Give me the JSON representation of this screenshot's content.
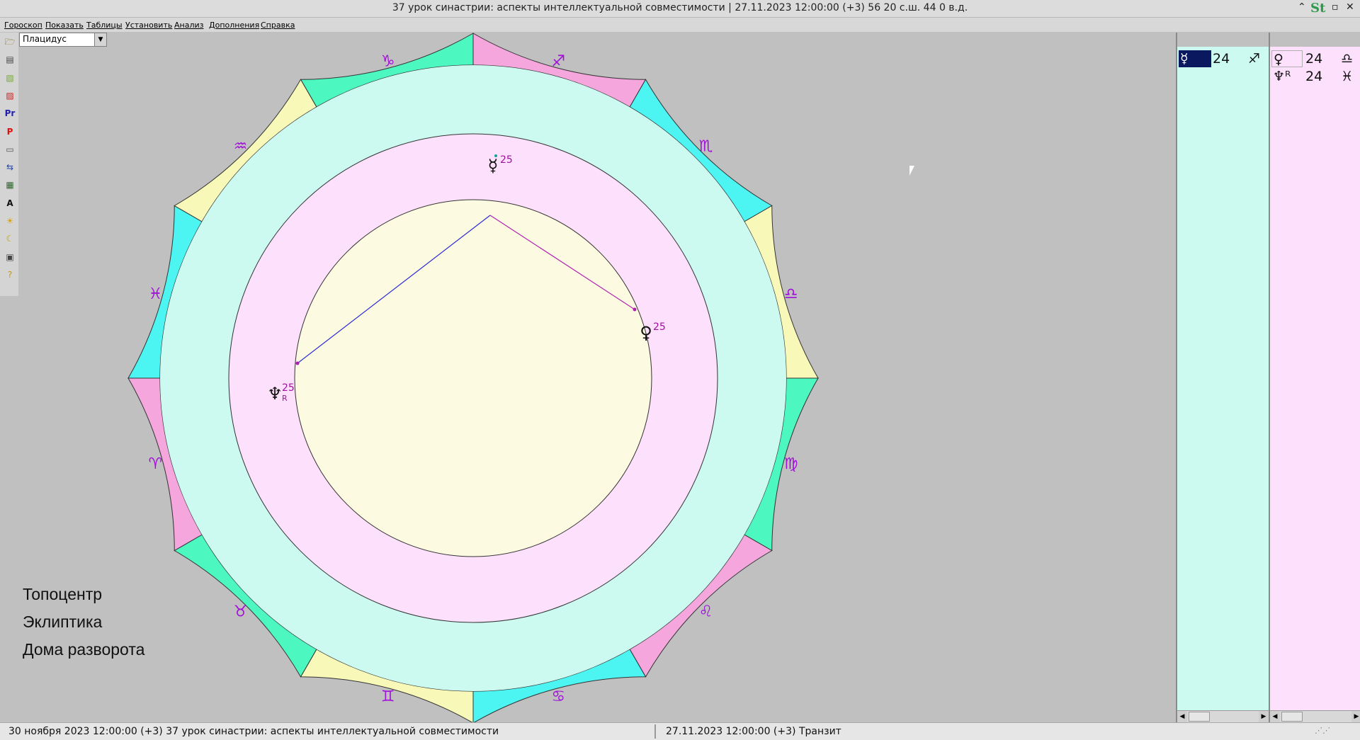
{
  "window": {
    "title": "37 урок синастрии: аспекты интеллектуальной совместимости |   27.11.2023 12:00:00 (+3)   56 20 с.ш. 44 0 в.д."
  },
  "menu": [
    "Гороскоп",
    "Показать",
    "Таблицы",
    "Установить",
    "Анализ",
    "Дополнения",
    "Справка"
  ],
  "house_system": {
    "selected": "Плацидус"
  },
  "toolbar_icons": [
    "open-folder-icon",
    "document-icon",
    "copy-icon",
    "print-icon",
    "pr-icon",
    "p-icon",
    "settings-icon",
    "arrows-icon",
    "table-icon",
    "font-a-icon",
    "sun-icon",
    "moon-icon",
    "grid-icon",
    "help-icon"
  ],
  "toolbar_glyphs": [
    "🗁",
    "▤",
    "▧",
    "▨",
    "Pr",
    "P",
    "▭",
    "⇆",
    "▦",
    "A",
    "☀",
    "☾",
    "▣",
    "?"
  ],
  "chart": {
    "zodiac": [
      {
        "sign": "♑",
        "color": "#4cf7c0"
      },
      {
        "sign": "♐",
        "color": "#f4a6dd"
      },
      {
        "sign": "♏",
        "color": "#4cf5f2"
      },
      {
        "sign": "♎",
        "color": "#f8f8b8"
      },
      {
        "sign": "♍",
        "color": "#4cf7c0"
      },
      {
        "sign": "♌",
        "color": "#f4a6dd"
      },
      {
        "sign": "♋",
        "color": "#4cf5f2"
      },
      {
        "sign": "♊",
        "color": "#f8f8b8"
      },
      {
        "sign": "♉",
        "color": "#4cf7c0"
      },
      {
        "sign": "♈",
        "color": "#f4a6dd"
      },
      {
        "sign": "♓",
        "color": "#4cf5f2"
      },
      {
        "sign": "♒",
        "color": "#f8f8b8"
      }
    ],
    "planets": [
      {
        "name": "mercury",
        "glyph": "☿",
        "degree": "25",
        "retro": ""
      },
      {
        "name": "venus",
        "glyph": "♀",
        "degree": "25",
        "retro": ""
      },
      {
        "name": "neptune",
        "glyph": "♆",
        "degree": "25",
        "retro": "R"
      }
    ],
    "colors": {
      "ring_outer": "#ccf9f0",
      "ring_middle": "#fde0fb",
      "center": "#fdfae2",
      "aspect_blue": "#2a2ad8",
      "aspect_purple": "#b020b0",
      "sign_glyph": "#a010d8"
    }
  },
  "info_lines": [
    "Топоцентр",
    "Эклиптика",
    "Дома разворота"
  ],
  "panel_left": {
    "rows": [
      {
        "glyph": "☿",
        "degree": "24",
        "sign": "♐",
        "selected": true
      }
    ]
  },
  "panel_right": {
    "rows": [
      {
        "glyph": "♀",
        "degree": "24",
        "sign": "♎"
      },
      {
        "glyph": "♆ᴿ",
        "degree": "24",
        "sign": "♓"
      }
    ]
  },
  "status": {
    "left": "30 ноября 2023  12:00:00 (+3)   37 урок синастрии: аспекты интеллектуальной совместимости",
    "right": "27.11.2023 12:00:00 (+3)  Транзит"
  }
}
